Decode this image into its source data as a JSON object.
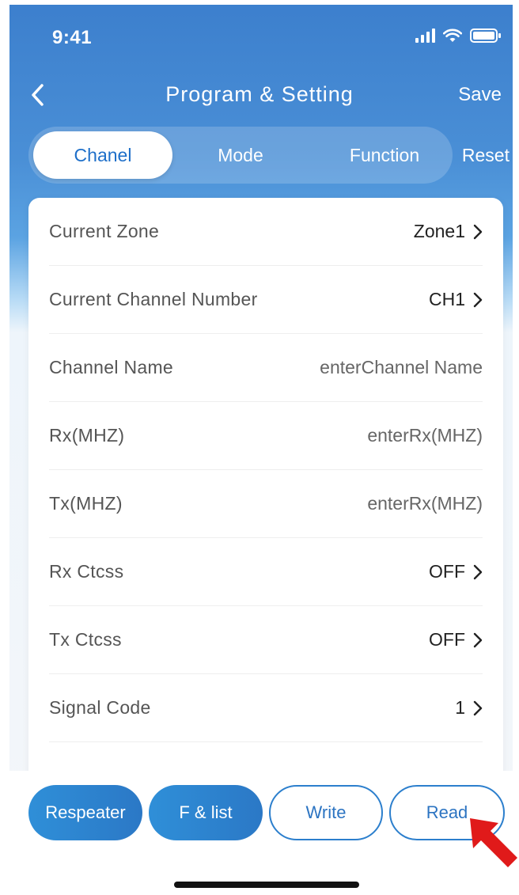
{
  "status_bar": {
    "time": "9:41"
  },
  "header": {
    "title": "Program & Setting",
    "save_label": "Save"
  },
  "tabs": [
    {
      "label": "Chanel",
      "active": true
    },
    {
      "label": "Mode",
      "active": false
    },
    {
      "label": "Function",
      "active": false
    }
  ],
  "reset_label": "Reset",
  "settings": [
    {
      "label": "Current Zone",
      "value": "Zone1",
      "has_chevron": true
    },
    {
      "label": "Current Channel Number",
      "value": "CH1",
      "has_chevron": true
    },
    {
      "label": "Channel Name",
      "placeholder": "enterChannel Name"
    },
    {
      "label": "Rx(MHZ)",
      "placeholder": "enterRx(MHZ)"
    },
    {
      "label": "Tx(MHZ)",
      "placeholder": "enterRx(MHZ)"
    },
    {
      "label": "Rx Ctcss",
      "value": "OFF",
      "has_chevron": true
    },
    {
      "label": "Tx Ctcss",
      "value": "OFF",
      "has_chevron": true
    },
    {
      "label": "Signal Code",
      "value": "1",
      "has_chevron": true
    }
  ],
  "actions": {
    "respeater_label": "Respeater",
    "f_list_label": "F & list",
    "write_label": "Write",
    "read_label": "Read"
  },
  "colors": {
    "accent": "#2c7fcd",
    "header_blue": "#3c7fcd",
    "arrow_red": "#e01a1a"
  }
}
